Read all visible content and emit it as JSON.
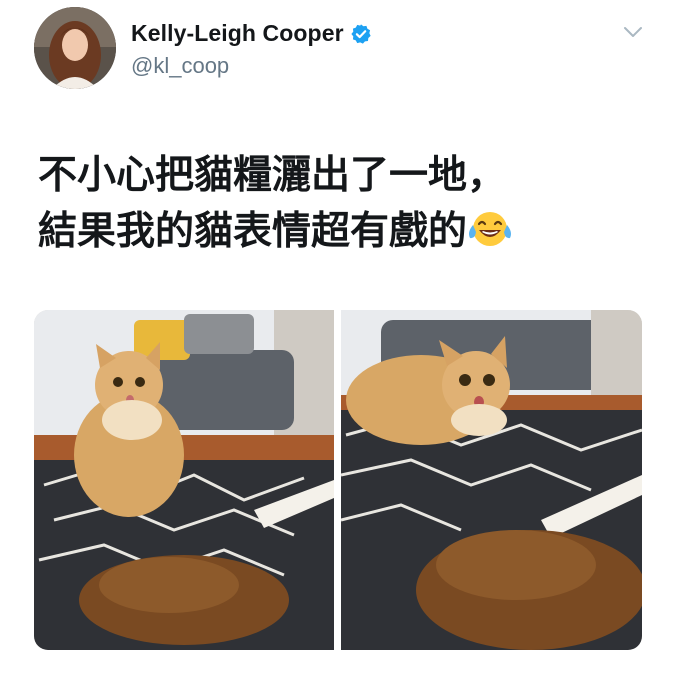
{
  "tweet": {
    "author": {
      "display_name": "Kelly-Leigh Cooper",
      "handle": "@kl_coop",
      "verified": true,
      "avatar_icon": "profile-photo"
    },
    "text": "不小心把貓糧灑出了一地，\n結果我的貓表情超有戲的",
    "emoji": "face-with-tears-of-joy",
    "media": [
      {
        "icon": "cat-photo-calm"
      },
      {
        "icon": "cat-photo-surprised"
      }
    ],
    "menu_icon": "chevron-down-icon"
  },
  "colors": {
    "name": "#14171a",
    "handle": "#657786",
    "verified": "#1da1f2",
    "background": "#ffffff"
  }
}
